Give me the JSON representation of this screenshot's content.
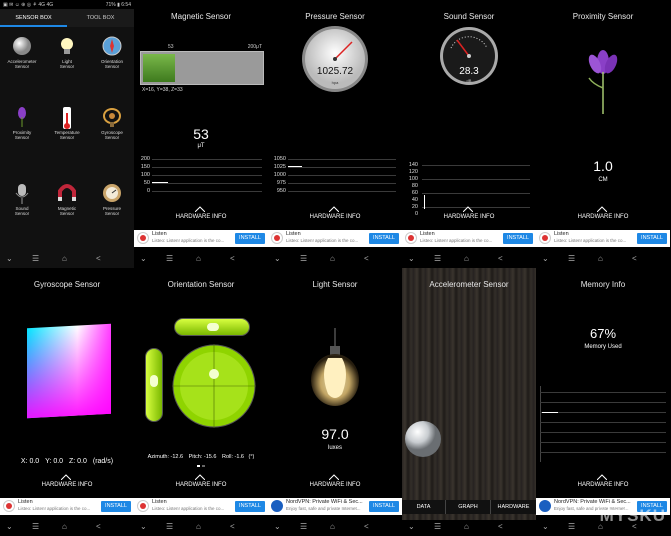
{
  "status_bar": {
    "left": "▣ ✉ ☺ ⊕ ◎ ⚘ 4G 4G",
    "right": "71% ▮ 6:54"
  },
  "sensor_box": {
    "tabs": [
      "SENSOR BOX",
      "TOOL BOX"
    ],
    "items": [
      {
        "label": "Accelerometer\nSensor",
        "icon": "accelerometer-icon"
      },
      {
        "label": "Light\nSensor",
        "icon": "light-bulb-icon"
      },
      {
        "label": "Orientation\nSensor",
        "icon": "compass-icon"
      },
      {
        "label": "Proximity\nSensor",
        "icon": "flower-icon"
      },
      {
        "label": "Temperature\nSensor",
        "icon": "thermometer-icon"
      },
      {
        "label": "Gyroscope\nSensor",
        "icon": "gyroscope-icon"
      },
      {
        "label": "Sound\nSensor",
        "icon": "microphone-icon"
      },
      {
        "label": "Magnetic\nSensor",
        "icon": "magnet-icon"
      },
      {
        "label": "Pressure\nSensor",
        "icon": "barometer-icon"
      }
    ]
  },
  "magnetic": {
    "title": "Magnetic Sensor",
    "bar_left": "53",
    "bar_right": "200μT",
    "bar_fill": 0.265,
    "xyz": "X=16, Y=38, Z=33",
    "value": "53",
    "unit": "μT",
    "ticks": [
      "200",
      "150",
      "100",
      "50",
      "0"
    ]
  },
  "pressure": {
    "title": "Pressure Sensor",
    "value": "1025.72",
    "unit": "hpa",
    "ticks": [
      "1050",
      "1025",
      "1000",
      "975",
      "950"
    ]
  },
  "sound": {
    "title": "Sound Sensor",
    "value": "28.3",
    "unit": "dB",
    "ticks": [
      "140",
      "120",
      "100",
      "80",
      "60",
      "40",
      "20",
      "0"
    ]
  },
  "proximity": {
    "title": "Proximity Sensor",
    "value": "1.0",
    "unit": "CM"
  },
  "gyroscope": {
    "title": "Gyroscope Sensor",
    "x": "X: 0.0",
    "y": "Y: 0.0",
    "z": "Z: 0.0",
    "unit": "(rad/s)"
  },
  "orientation": {
    "title": "Orientation Sensor",
    "azimuth": "Azimuth: -12.6",
    "pitch": "Pitch: -15.6",
    "roll": "Roll: -1.6",
    "unit": "(°)"
  },
  "light": {
    "title": "Light Sensor",
    "value": "97.0",
    "unit": "luxes"
  },
  "accelerometer": {
    "title": "Accelerometer Sensor",
    "tabs": [
      "DATA",
      "GRAPH",
      "HARDWARE"
    ]
  },
  "memory": {
    "title": "Memory Info",
    "value": "67%",
    "caption": "Memory Used"
  },
  "hardware_info": "HARDWARE INFO",
  "ads": {
    "listen_title": "Listen",
    "listen_body": "Listeo: Listen! application is the co...",
    "nord_title": "NordVPN: Private WiFi & Sec...",
    "nord_body": "Enjoy fast, safe and private Internet...",
    "install": "INSTALL"
  },
  "nav": {
    "back": "<",
    "home": "⌂",
    "recents": "☰",
    "down": "⌄"
  },
  "watermark": "MYSKU",
  "colors": {
    "accent_green": "#8fd400",
    "ad_blue": "#1e88e5",
    "purple_flower": "#8a3fc7"
  }
}
